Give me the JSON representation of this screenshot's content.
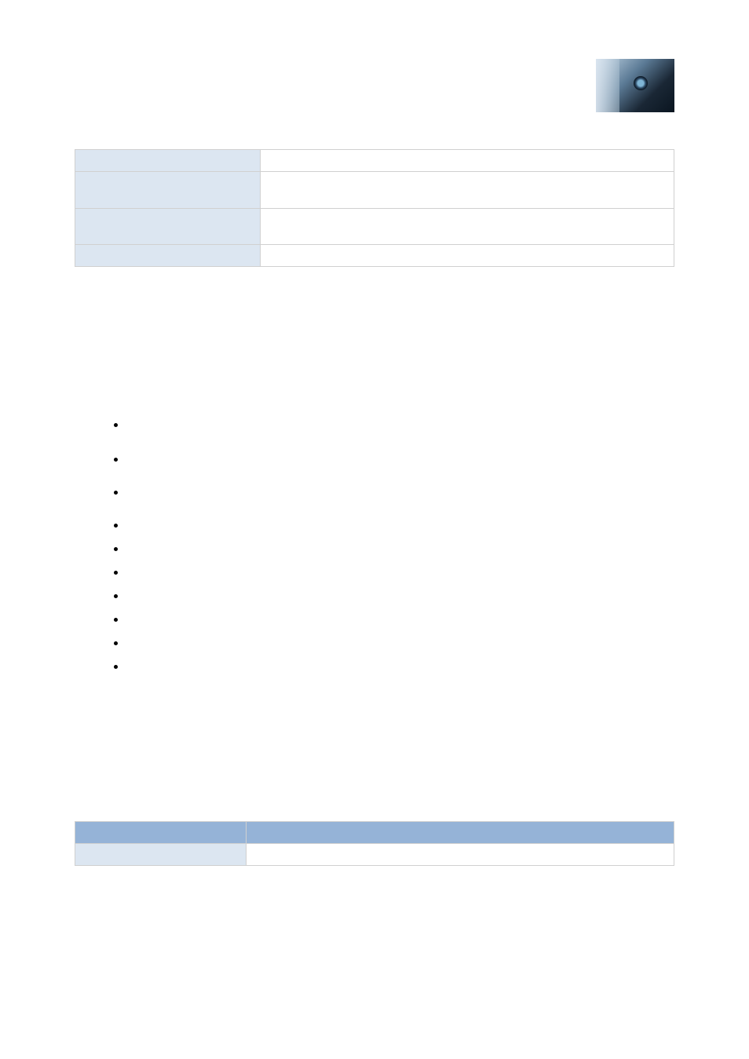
{
  "table1": {
    "rows": [
      {
        "label": "",
        "value": ""
      },
      {
        "label": "",
        "value": ""
      },
      {
        "label": "",
        "value": ""
      },
      {
        "label": "",
        "value": ""
      }
    ]
  },
  "bullets": [
    {
      "text": ""
    },
    {
      "text": ""
    },
    {
      "text": ""
    },
    {
      "text": ""
    },
    {
      "text": ""
    },
    {
      "text": ""
    },
    {
      "text": ""
    },
    {
      "text": ""
    },
    {
      "text": ""
    },
    {
      "text": ""
    }
  ],
  "table2": {
    "header": {
      "col1": "",
      "col2": ""
    },
    "row1": {
      "label": "",
      "value": ""
    }
  }
}
